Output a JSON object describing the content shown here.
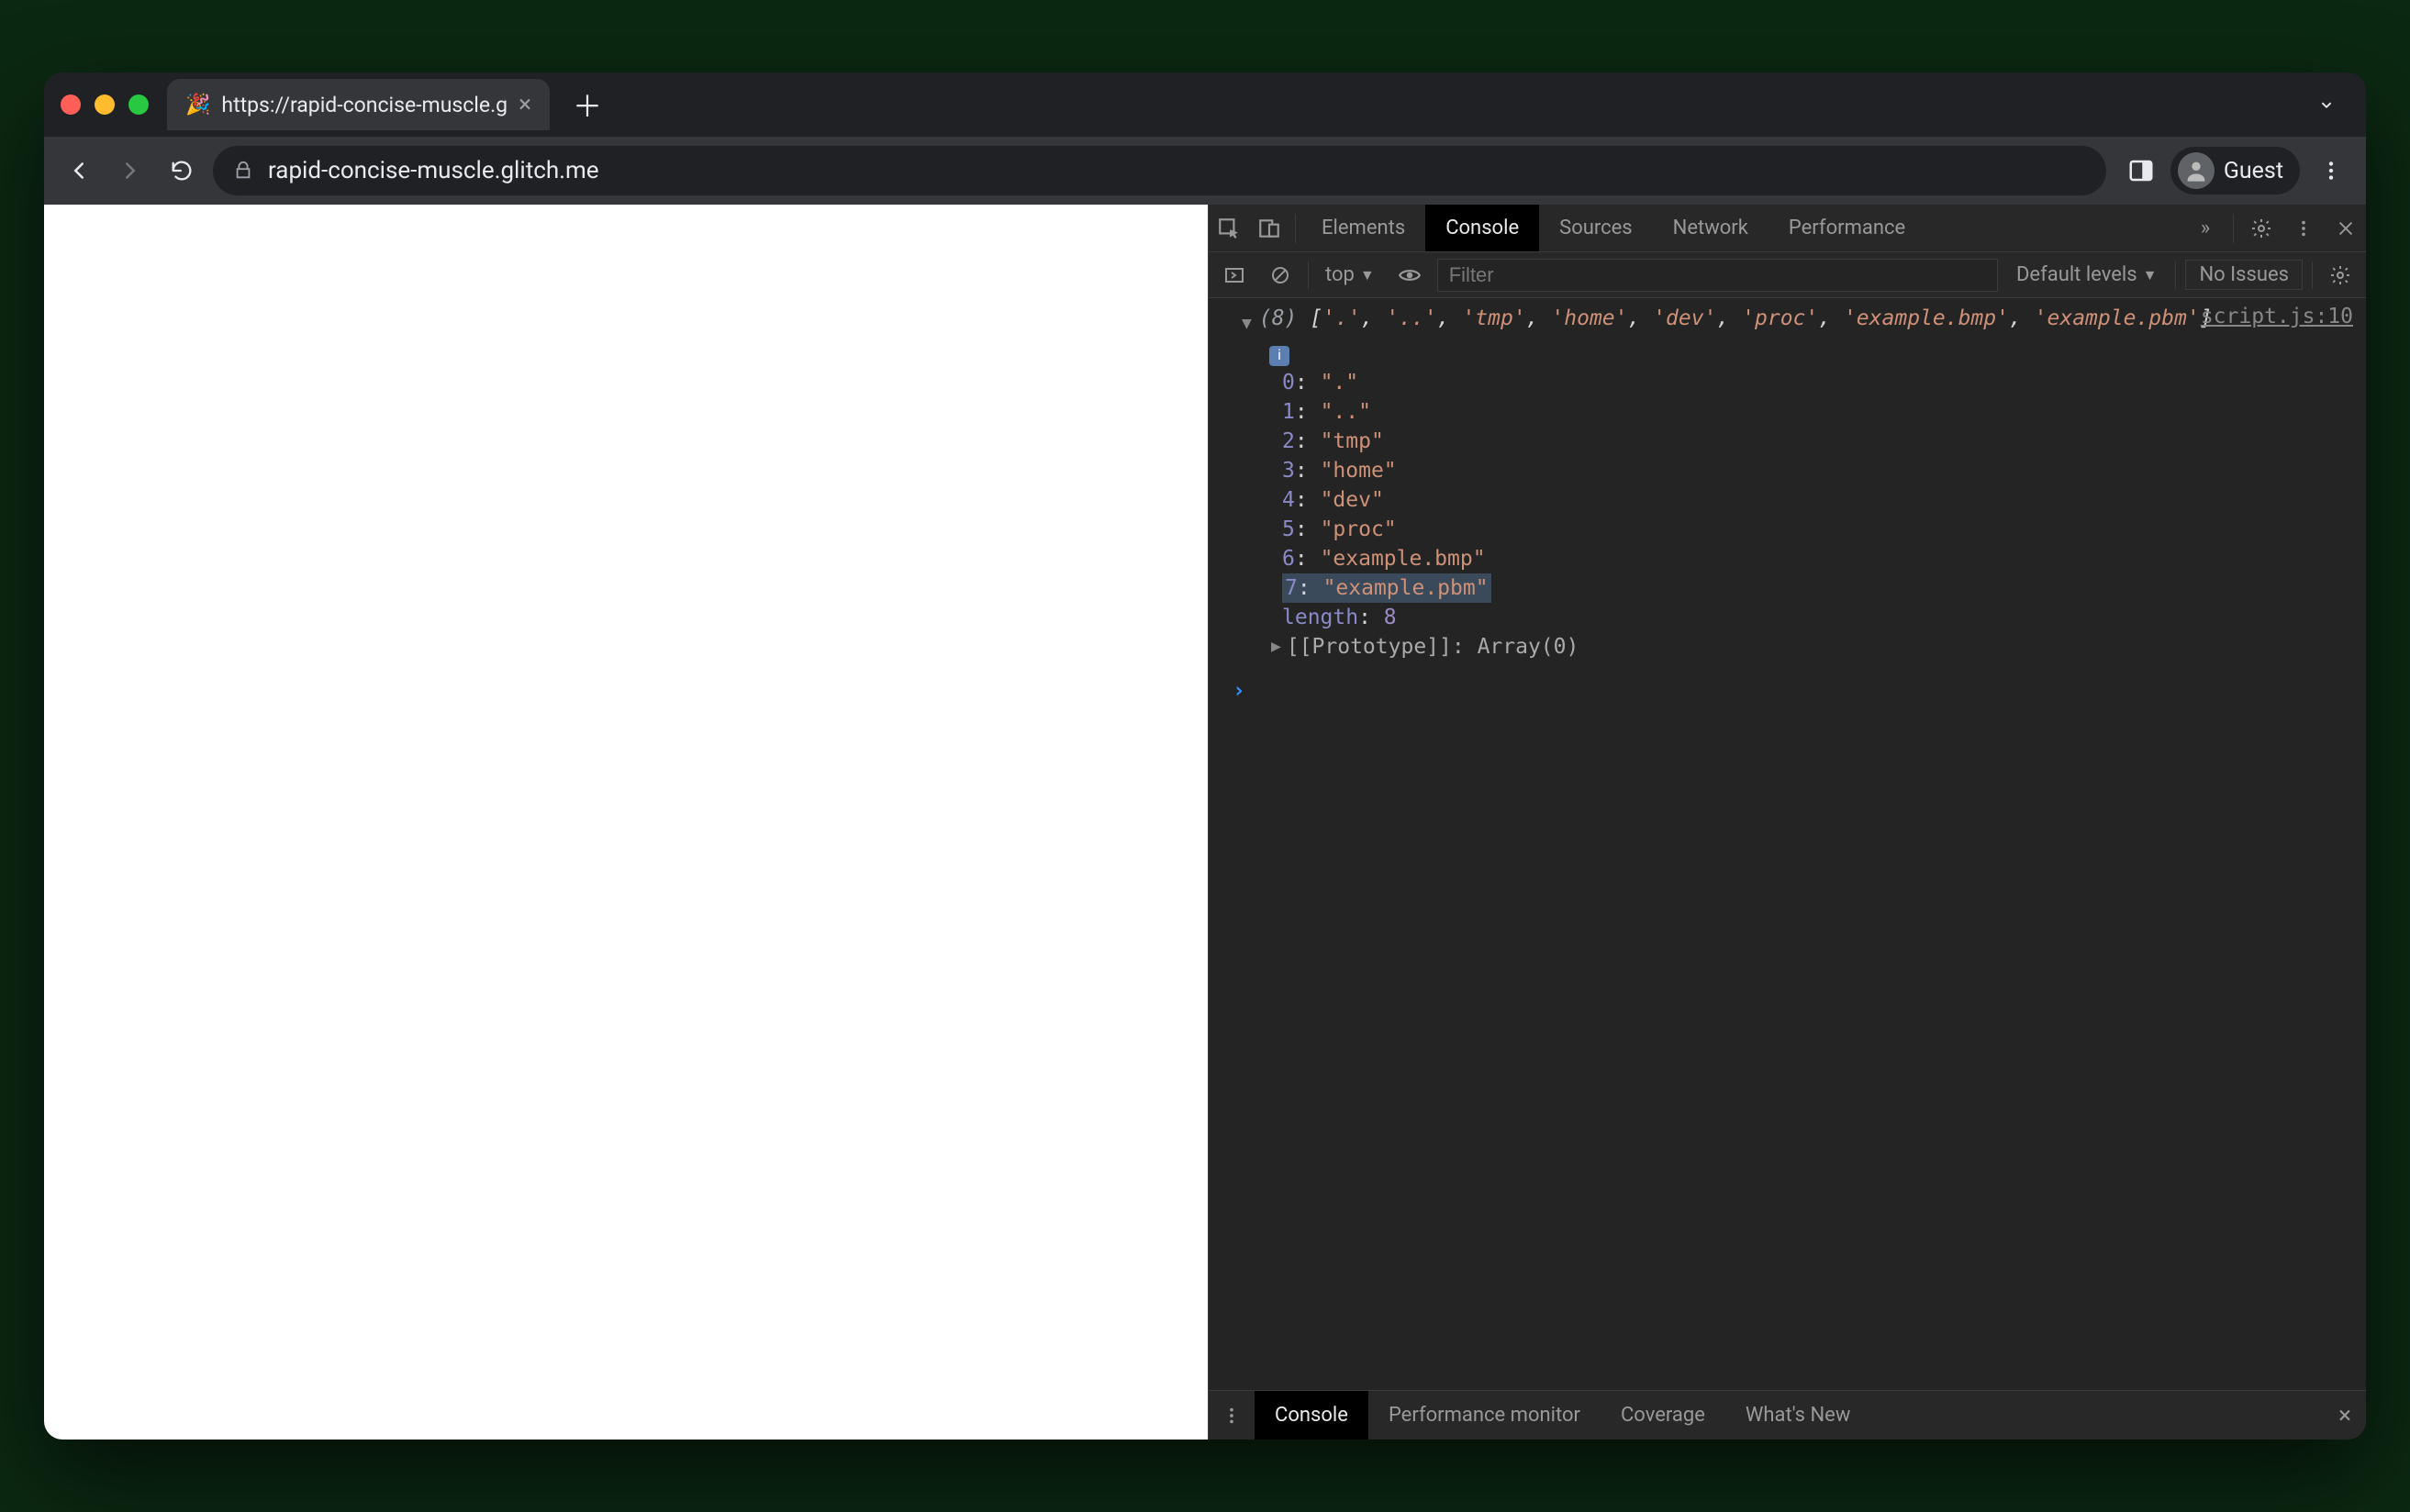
{
  "browser": {
    "tab": {
      "favicon": "🎉",
      "title": "https://rapid-concise-muscle.g",
      "close_glyph": "×"
    },
    "newtab_glyph": "＋",
    "url": "rapid-concise-muscle.glitch.me",
    "profile_label": "Guest"
  },
  "devtools": {
    "tabs": [
      "Elements",
      "Console",
      "Sources",
      "Network",
      "Performance"
    ],
    "active_tab": "Console",
    "more_tabs_glyph": "»",
    "subbar": {
      "context": "top",
      "filter_placeholder": "Filter",
      "levels_label": "Default levels",
      "issues_label": "No Issues"
    },
    "source_link": "script.js:10",
    "array_len": "(8)",
    "array_preview": [
      "'.'",
      "'..'",
      "'tmp'",
      "'home'",
      "'dev'",
      "'proc'",
      "'example.bmp'",
      "'example.pbm'"
    ],
    "entries": [
      {
        "k": "0",
        "v": "\".\""
      },
      {
        "k": "1",
        "v": "\"..\""
      },
      {
        "k": "2",
        "v": "\"tmp\""
      },
      {
        "k": "3",
        "v": "\"home\""
      },
      {
        "k": "4",
        "v": "\"dev\""
      },
      {
        "k": "5",
        "v": "\"proc\""
      },
      {
        "k": "6",
        "v": "\"example.bmp\""
      },
      {
        "k": "7",
        "v": "\"example.pbm\""
      }
    ],
    "selected_entry_index": 7,
    "length_label": "length",
    "length_value": "8",
    "prototype_label": "[[Prototype]]",
    "prototype_value": "Array(0)",
    "drawer": {
      "tabs": [
        "Console",
        "Performance monitor",
        "Coverage",
        "What's New"
      ],
      "active": "Console"
    }
  }
}
